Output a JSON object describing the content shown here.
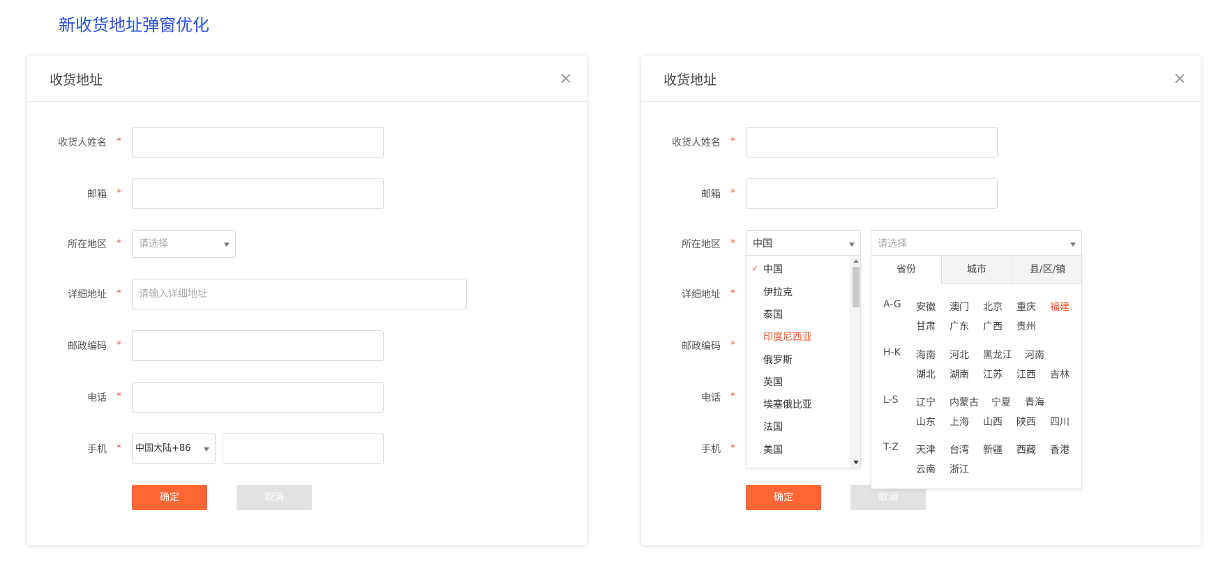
{
  "page": {
    "title": "新收货地址弹窗优化"
  },
  "dialog": {
    "title": "收货地址",
    "close_icon": "close-icon",
    "fields": {
      "name_label": "收货人姓名",
      "email_label": "邮箱",
      "region_label": "所在地区",
      "address_label": "详细地址",
      "address_placeholder": "请输入详细地址",
      "zip_label": "邮政编码",
      "phone_label": "电话",
      "mobile_label": "手机",
      "required_mark": "*"
    },
    "region_select_placeholder": "请选择",
    "mobile_country_code": "中国大陆+86",
    "confirm_label": "确定",
    "cancel_label": "取消"
  },
  "dialog_right": {
    "country_selected": "中国",
    "subregion_placeholder": "请选择",
    "countries": [
      "中国",
      "伊拉克",
      "泰国",
      "印度尼西亚",
      "俄罗斯",
      "英国",
      "埃塞俄比亚",
      "法国",
      "美国"
    ],
    "highlighted_country": "印度尼西亚",
    "tabs": [
      "省份",
      "城市",
      "县/区/镇"
    ],
    "active_tab": "省份",
    "provinces": [
      {
        "key": "A-G",
        "row1": [
          "安徽",
          "澳门",
          "北京",
          "重庆",
          "福建"
        ],
        "row2": [
          "甘肃",
          "广东",
          "广西",
          "贵州"
        ]
      },
      {
        "key": "H-K",
        "row1": [
          "海南",
          "河北",
          "黑龙江",
          "河南"
        ],
        "row2": [
          "湖北",
          "湖南",
          "江苏",
          "江西",
          "吉林"
        ]
      },
      {
        "key": "L-S",
        "row1": [
          "辽宁",
          "内蒙古",
          "宁夏",
          "青海"
        ],
        "row2": [
          "山东",
          "上海",
          "山西",
          "陕西",
          "四川"
        ]
      },
      {
        "key": "T-Z",
        "row1": [
          "天津",
          "台湾",
          "新疆",
          "西藏",
          "香港"
        ],
        "row2": [
          "云南",
          "浙江"
        ]
      }
    ],
    "highlighted_province": "福建"
  },
  "colors": {
    "accent": "#ff6633",
    "title_blue": "#2b4fe0",
    "required": "#f1592a"
  }
}
